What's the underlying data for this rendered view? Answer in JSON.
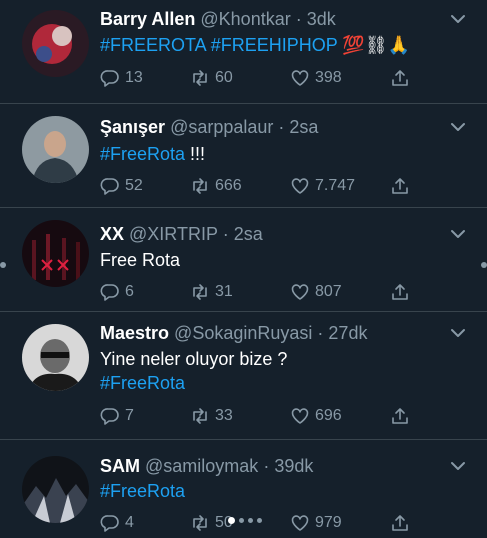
{
  "tweets": [
    {
      "name": "Barry Allen",
      "handle": "@Khontkar",
      "separator": "·",
      "time": "3dk",
      "body": [
        [
          {
            "text": "#FREEROTA #FREEHIPHOP",
            "hashtag": true
          },
          {
            "text": " 💯⛓🙏",
            "hashtag": false
          }
        ]
      ],
      "replies": "13",
      "retweets": "60",
      "likes": "398",
      "avatar_icon": "profile-photo"
    },
    {
      "name": "Şanışer",
      "handle": "@sarppalaur",
      "separator": "·",
      "time": "2sa",
      "body": [
        [
          {
            "text": "#FreeRota",
            "hashtag": true
          },
          {
            "text": " !!!",
            "hashtag": false
          }
        ]
      ],
      "replies": "52",
      "retweets": "666",
      "likes": "7.747",
      "avatar_icon": "profile-photo"
    },
    {
      "name": "XX",
      "handle": "@XIRTRIP",
      "separator": "·",
      "time": "2sa",
      "body": [
        [
          {
            "text": "Free Rota",
            "hashtag": false
          }
        ]
      ],
      "replies": "6",
      "retweets": "31",
      "likes": "807",
      "avatar_icon": "profile-photo"
    },
    {
      "name": "Maestro",
      "handle": "@SokaginRuyasi",
      "separator": "·",
      "time": "27dk",
      "body": [
        [
          {
            "text": "Yine neler oluyor bize ?",
            "hashtag": false
          }
        ],
        [
          {
            "text": "#FreeRota",
            "hashtag": true
          }
        ]
      ],
      "replies": "7",
      "retweets": "33",
      "likes": "696",
      "avatar_icon": "profile-photo"
    },
    {
      "name": "SAM",
      "handle": "@samiloymak",
      "separator": "·",
      "time": "39dk",
      "body": [
        [
          {
            "text": "#FreeRota",
            "hashtag": true
          }
        ]
      ],
      "replies": "4",
      "retweets": "50",
      "likes": "979",
      "avatar_icon": "profile-photo"
    }
  ],
  "icons": {
    "reply": "reply-icon",
    "retweet": "retweet-icon",
    "like": "like-icon",
    "share": "share-icon",
    "menu": "chevron-down-icon"
  },
  "colors": {
    "background": "#15202b",
    "text": "#ffffff",
    "muted": "#8899a6",
    "hashtag": "#1da1f2",
    "divider": "#38444d"
  }
}
